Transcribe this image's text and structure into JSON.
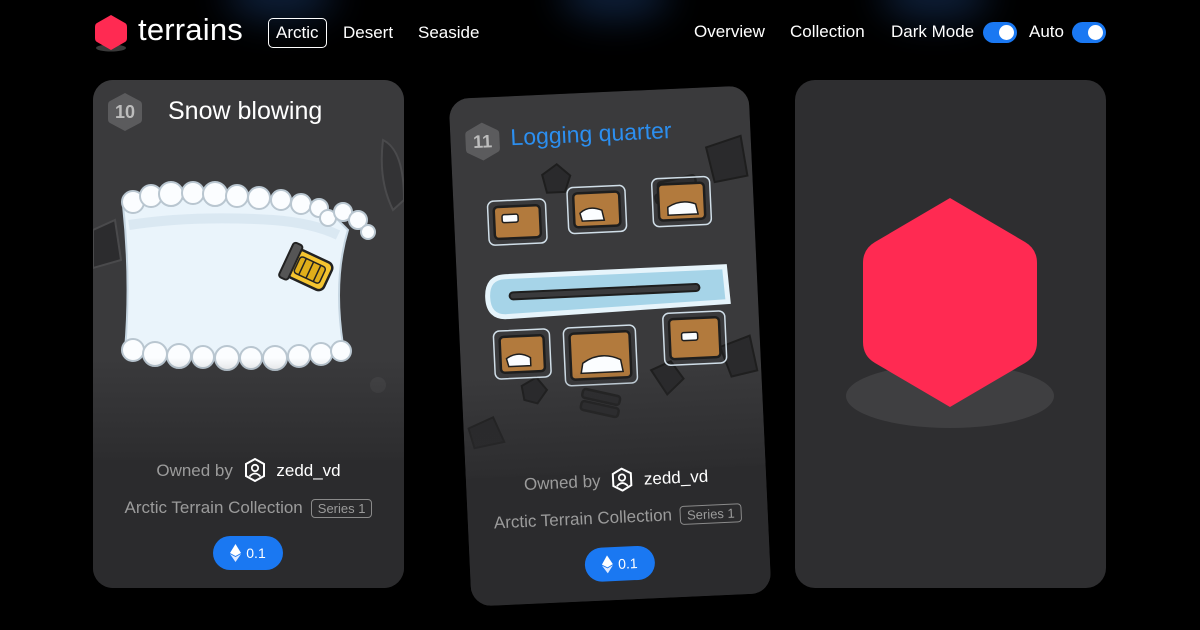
{
  "brand": {
    "name": "terrains",
    "accent": "#ff2a52"
  },
  "nav": {
    "tabs": [
      {
        "label": "Arctic",
        "active": true
      },
      {
        "label": "Desert",
        "active": false
      },
      {
        "label": "Seaside",
        "active": false
      }
    ],
    "overview": "Overview",
    "collection": "Collection",
    "dark_mode": {
      "label": "Dark Mode",
      "on": true
    },
    "auto": {
      "label": "Auto",
      "on": true
    }
  },
  "cards": [
    {
      "number": "10",
      "title": "Snow blowing",
      "title_color": "#ffffff",
      "owned_label": "Owned by",
      "owner": "zedd_vd",
      "collection": "Arctic Terrain Collection",
      "series": "Series 1",
      "price": "0.1",
      "price_icon": "ethereum-icon"
    },
    {
      "number": "11",
      "title": "Logging quarter",
      "title_color": "#2c8ff0",
      "owned_label": "Owned by",
      "owner": "zedd_vd",
      "collection": "Arctic Terrain Collection",
      "series": "Series 1",
      "price": "0.1",
      "price_icon": "ethereum-icon"
    }
  ],
  "colors": {
    "toggle": "#1a78f2",
    "price_pill": "#1a78f2",
    "card_bg": "#2b2b2d"
  }
}
